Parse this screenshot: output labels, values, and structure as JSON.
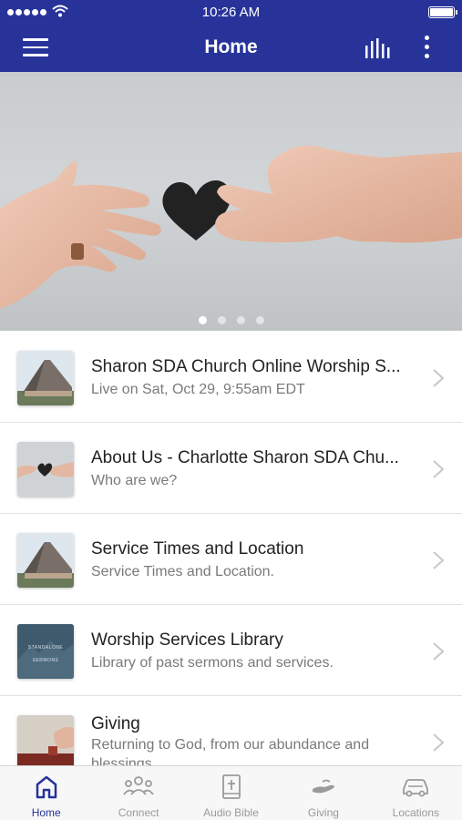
{
  "status_bar": {
    "time": "10:26 AM"
  },
  "header": {
    "title": "Home"
  },
  "hero": {
    "slide_count": 4,
    "active_index": 0
  },
  "items": [
    {
      "title": "Sharon SDA Church Online Worship S...",
      "subtitle": "Live on Sat, Oct 29, 9:55am EDT",
      "thumb": "church-building"
    },
    {
      "title": "About Us - Charlotte Sharon SDA Chu...",
      "subtitle": "Who are we?",
      "thumb": "hands-heart"
    },
    {
      "title": "Service Times and Location",
      "subtitle": "Service Times and Location.",
      "thumb": "church-building"
    },
    {
      "title": "Worship Services Library",
      "subtitle": "Library of past sermons and services.",
      "thumb": "standalone-sermons",
      "thumb_text": [
        "STANDALONE",
        "SERMONS"
      ]
    },
    {
      "title": "Giving",
      "subtitle": "Returning to God, from our abundance and blessings.",
      "thumb": "giving-hand"
    }
  ],
  "tabs": [
    {
      "label": "Home",
      "icon": "home-icon",
      "active": true
    },
    {
      "label": "Connect",
      "icon": "people-icon",
      "active": false
    },
    {
      "label": "Audio Bible",
      "icon": "bible-icon",
      "active": false
    },
    {
      "label": "Giving",
      "icon": "giving-icon",
      "active": false
    },
    {
      "label": "Locations",
      "icon": "car-icon",
      "active": false
    }
  ],
  "colors": {
    "brand": "#28339a",
    "tab_inactive": "#9a9a9a",
    "subtitle": "#7a7a7a"
  }
}
